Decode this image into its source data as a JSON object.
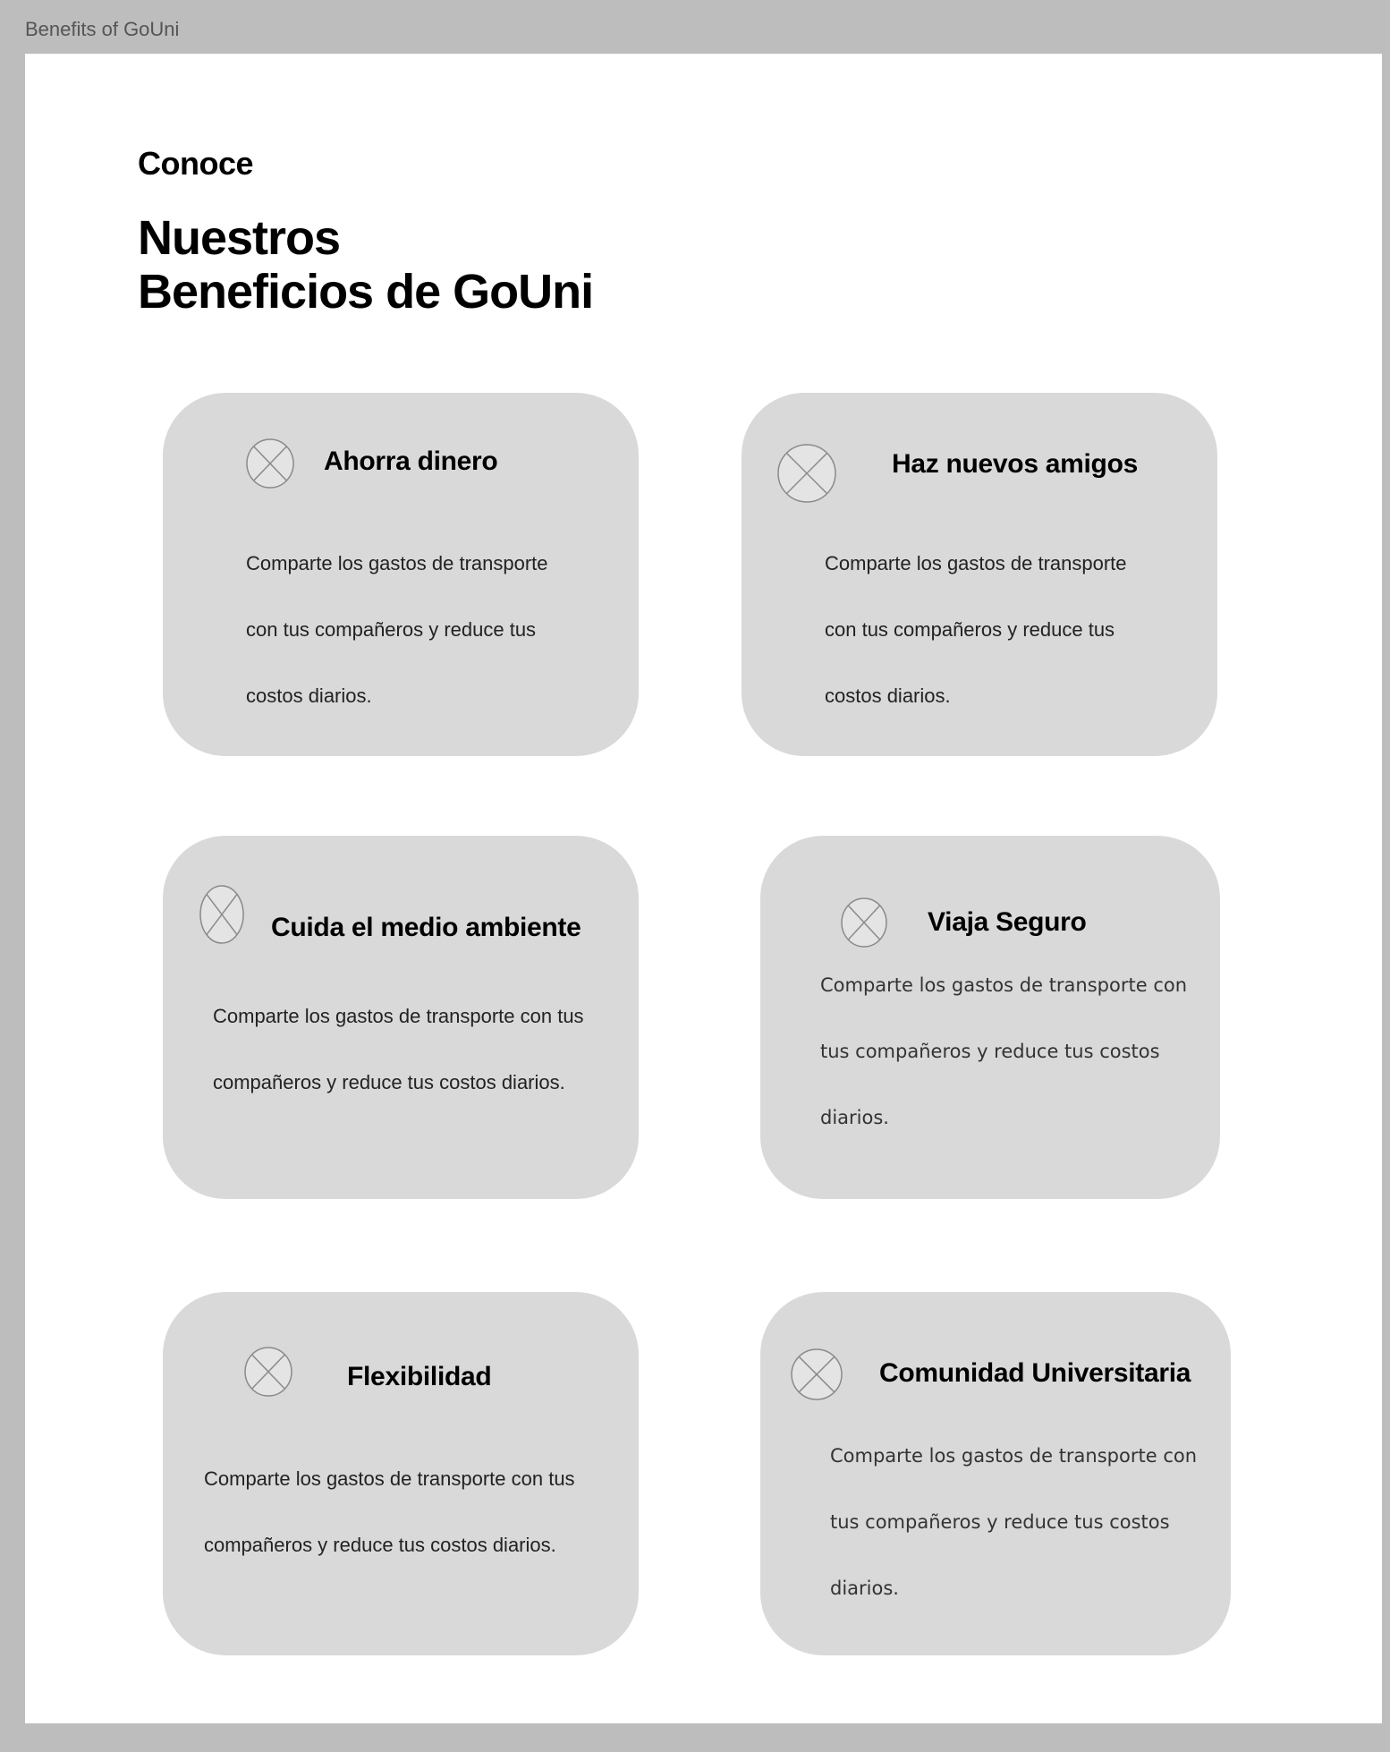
{
  "frame": {
    "label": "Benefits of GoUni"
  },
  "header": {
    "eyebrow": "Conoce",
    "title_line1": "Nuestros",
    "title_line2": "Beneficios de GoUni"
  },
  "cards": [
    {
      "icon": "image-placeholder-icon",
      "title": "Ahorra dinero",
      "text": "Comparte los gastos de transporte con tus compañeros y reduce tus costos diarios."
    },
    {
      "icon": "image-placeholder-icon",
      "title": "Haz nuevos amigos",
      "text": "Comparte los gastos de transporte con tus compañeros y reduce tus costos diarios."
    },
    {
      "icon": "image-placeholder-icon",
      "title": "Cuida el medio ambiente",
      "text": "Comparte los gastos de transporte con tus compañeros y reduce tus costos diarios."
    },
    {
      "icon": "image-placeholder-icon",
      "title": "Viaja Seguro",
      "text": "Comparte los gastos de transporte con tus compañeros y reduce tus costos diarios."
    },
    {
      "icon": "image-placeholder-icon",
      "title": "Flexibilidad",
      "text": "Comparte los gastos de transporte con tus compañeros y reduce tus costos diarios."
    },
    {
      "icon": "image-placeholder-icon",
      "title": "Comunidad Universitaria",
      "text": "Comparte los gastos de transporte con tus compañeros y reduce tus costos diarios."
    }
  ],
  "colors": {
    "canvas_background": "#bdbdbd",
    "frame_background": "#ffffff",
    "card_background": "#d9d9d9",
    "placeholder_stroke": "#8a8a8a",
    "text_primary": "#000000"
  }
}
